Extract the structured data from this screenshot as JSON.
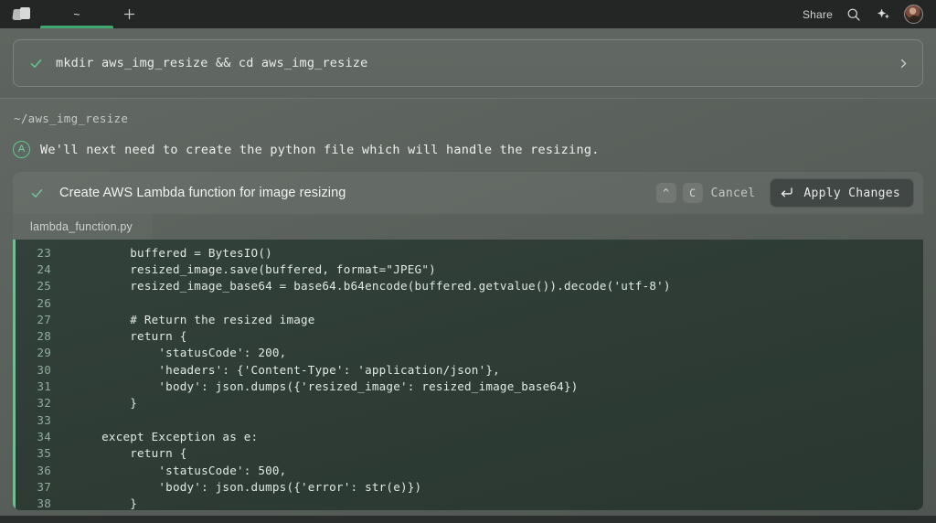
{
  "window": {
    "app_name": "Warp",
    "logo_icon": "warp-logo-icon"
  },
  "titlebar": {
    "tabs": [
      {
        "label": "~",
        "active": true
      }
    ],
    "new_tab_icon": "plus-icon",
    "share_label": "Share",
    "search_icon": "search-icon",
    "ai_icon": "sparkle-icon",
    "avatar_icon": "user-avatar",
    "accent_color": "#3fa96b"
  },
  "command_block": {
    "status_icon": "checkmark-icon",
    "status_color": "#5ec98c",
    "command": "mkdir aws_img_resize && cd aws_img_resize",
    "expand_icon": "chevron-right-icon"
  },
  "conversation": {
    "cwd": "~/aws_img_resize",
    "agent_badge": "A",
    "agent_badge_color": "#6fd79a",
    "message": "We'll next need to create the python file which will handle the resizing."
  },
  "action_card": {
    "status_icon": "checkmark-icon",
    "title": "Create AWS Lambda function for image resizing",
    "keycaps": [
      "^",
      "C"
    ],
    "cancel_label": "Cancel",
    "apply_icon": "return-arrow-icon",
    "apply_label": "Apply Changes",
    "file_tabs": [
      {
        "label": "lambda_function.py",
        "active": true
      }
    ]
  },
  "code": {
    "language": "python",
    "diff_accent_color": "#66c48f",
    "lines": [
      {
        "num": "23",
        "text": "        buffered = BytesIO()"
      },
      {
        "num": "24",
        "text": "        resized_image.save(buffered, format=\"JPEG\")"
      },
      {
        "num": "25",
        "text": "        resized_image_base64 = base64.b64encode(buffered.getvalue()).decode('utf-8')"
      },
      {
        "num": "26",
        "text": ""
      },
      {
        "num": "27",
        "text": "        # Return the resized image"
      },
      {
        "num": "28",
        "text": "        return {"
      },
      {
        "num": "29",
        "text": "            'statusCode': 200,"
      },
      {
        "num": "30",
        "text": "            'headers': {'Content-Type': 'application/json'},"
      },
      {
        "num": "31",
        "text": "            'body': json.dumps({'resized_image': resized_image_base64})"
      },
      {
        "num": "32",
        "text": "        }"
      },
      {
        "num": "33",
        "text": ""
      },
      {
        "num": "34",
        "text": "    except Exception as e:"
      },
      {
        "num": "35",
        "text": "        return {"
      },
      {
        "num": "36",
        "text": "            'statusCode': 500,"
      },
      {
        "num": "37",
        "text": "            'body': json.dumps({'error': str(e)})"
      },
      {
        "num": "38",
        "text": "        }"
      }
    ]
  }
}
